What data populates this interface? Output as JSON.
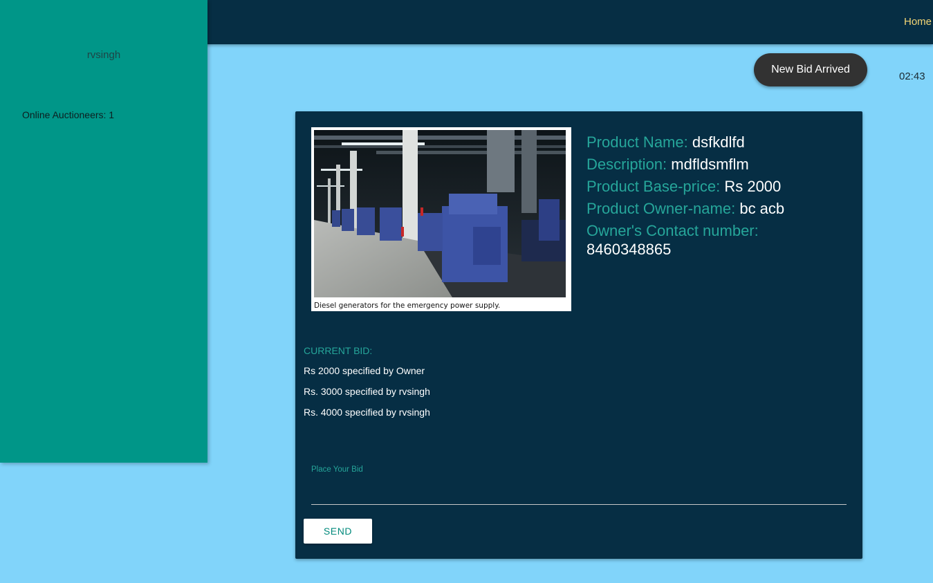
{
  "nav": {
    "home_label": "Home"
  },
  "sidebar": {
    "username": "rvsingh",
    "online_label": "Online Auctioneers: 1"
  },
  "toast": {
    "text": "New Bid Arrived"
  },
  "clock": {
    "time": "02:43"
  },
  "product": {
    "image_caption": "Diesel generators for the emergency power supply.",
    "name_label": "Product Name:",
    "name_value": "dsfkdlfd",
    "desc_label": "Description:",
    "desc_value": "mdfldsmflm",
    "price_label": "Product Base-price:",
    "price_value": "Rs 2000",
    "owner_label": "Product Owner-name:",
    "owner_value": "bc acb",
    "contact_label": "Owner's Contact number:",
    "contact_value": "8460348865"
  },
  "bids": {
    "heading": "CURRENT BID:",
    "entries": [
      "Rs 2000 specified by Owner",
      "Rs. 3000 specified by rvsingh",
      "Rs. 4000 specified by rvsingh"
    ]
  },
  "bid_form": {
    "label": "Place Your Bid",
    "value": "",
    "send_label": "SEND"
  },
  "colors": {
    "page_bg": "#81d4fa",
    "topbar_bg": "#062e44",
    "sidebar_bg": "#009688",
    "accent_teal": "#26a69a",
    "home_link": "#f4d675",
    "toast_bg": "#323232"
  }
}
